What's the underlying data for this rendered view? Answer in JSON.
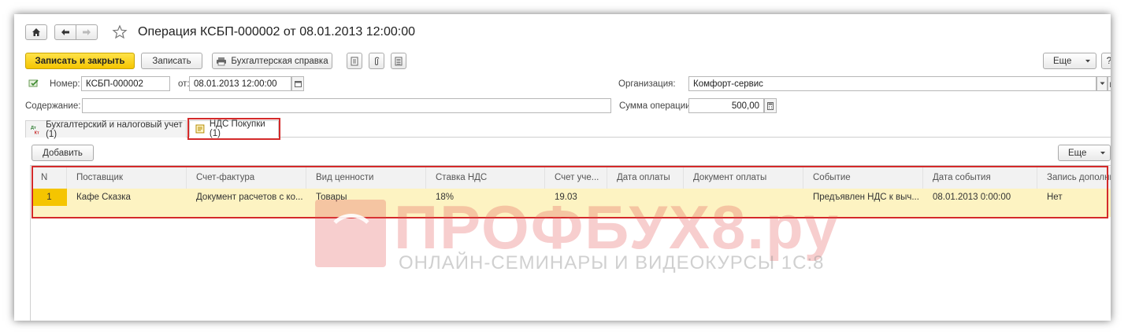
{
  "header": {
    "title": "Операция КСБП-000002 от 08.01.2013 12:00:00"
  },
  "toolbar": {
    "save_close": "Записать и закрыть",
    "save": "Записать",
    "report": "Бухгалтерская справка",
    "more": "Еще",
    "help": "?"
  },
  "form": {
    "number_label": "Номер:",
    "number_value": "КСБП-000002",
    "date_label": "от:",
    "date_value": "08.01.2013 12:00:00",
    "org_label": "Организация:",
    "org_value": "Комфорт-сервис",
    "content_label": "Содержание:",
    "content_value": "",
    "sum_label": "Сумма операции:",
    "sum_value": "500,00"
  },
  "tabs": [
    {
      "label": "Бухгалтерский и налоговый учет (1)",
      "active": false
    },
    {
      "label": "НДС Покупки (1)",
      "active": true
    }
  ],
  "tab_toolbar": {
    "add": "Добавить",
    "more": "Еще"
  },
  "table": {
    "columns": [
      "N",
      "Поставщик",
      "Счет-фактура",
      "Вид ценности",
      "Ставка НДС",
      "Счет уче...",
      "Дата оплаты",
      "Документ оплаты",
      "Событие",
      "Дата события",
      "Запись дополните..."
    ],
    "rows": [
      [
        "1",
        "Кафе Сказка",
        "Документ расчетов с ко...",
        "Товары",
        "18%",
        "19.03",
        "",
        "",
        "Предъявлен НДС к выч...",
        "08.01.2013 0:00:00",
        "Нет"
      ]
    ]
  },
  "watermark": {
    "brand": "ПРОФБУХ8.ру",
    "tagline": "ОНЛАЙН-СЕМИНАРЫ И ВИДЕОКУРСЫ 1С:8"
  },
  "colors": {
    "accent_yellow": "#f5c500",
    "highlight_red": "#d42a2a",
    "row_selected": "#fdf3c2"
  }
}
